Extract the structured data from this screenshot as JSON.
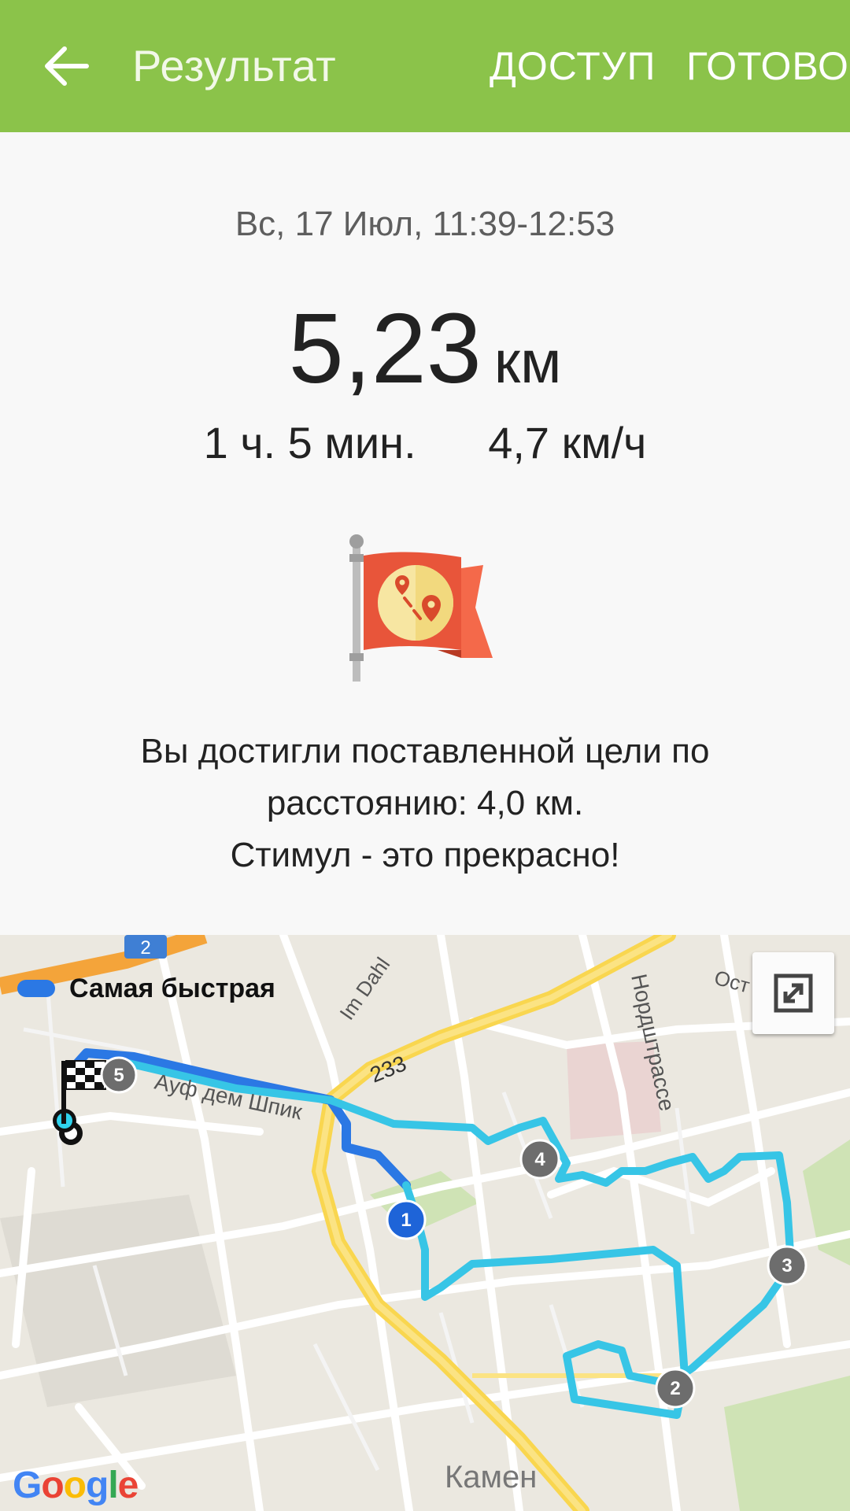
{
  "appbar": {
    "title": "Результат",
    "share_label": "ДОСТУП",
    "done_label": "ГОТОВО",
    "color": "#8bc34a"
  },
  "summary": {
    "date_time": "Вс, 17 Июл, 11:39-12:53",
    "distance_value": "5,23",
    "distance_unit": "км",
    "duration": "1 ч. 5 мин.",
    "speed": "4,7 км/ч"
  },
  "goal": {
    "line1": "Вы достигли поставленной цели по",
    "line2": "расстоянию: 4,0 км.",
    "line3": "Стимул - это прекрасно!"
  },
  "map": {
    "legend_label": "Самая быстрая",
    "route_color": "#2b78e4",
    "track_color": "#3cc8e8",
    "streets": {
      "im_dahl": "Im Dahl",
      "auf_dem_spiek": "Ауф дем Шпик",
      "nordstrasse": "Нордштрассе",
      "road_233": "233",
      "road_2": "2",
      "ost": "Ост",
      "kamen": "Камен"
    },
    "markers": [
      "1",
      "2",
      "3",
      "4",
      "5"
    ],
    "attribution": "Google"
  }
}
